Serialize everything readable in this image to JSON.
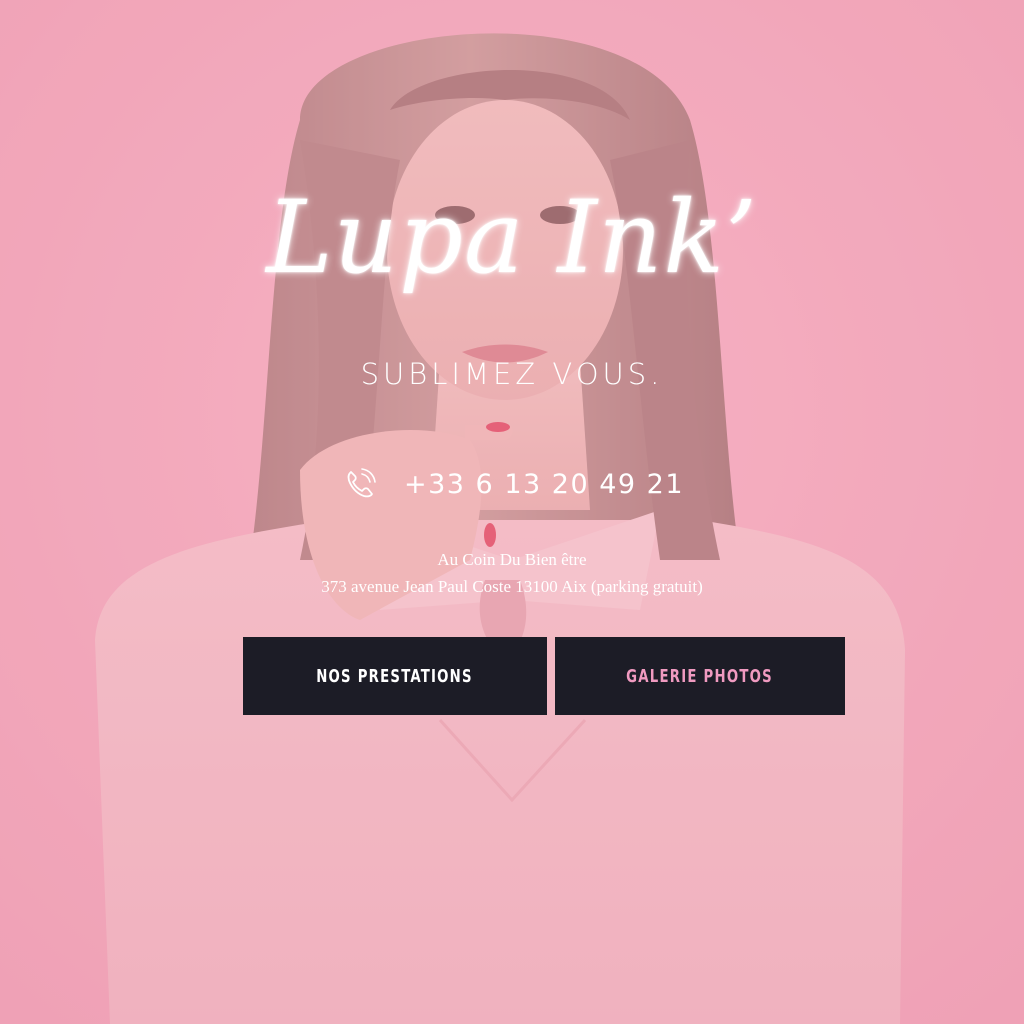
{
  "hero": {
    "logo": "Lupa Ink’",
    "tagline": "SUBLIMEZ VOUS.",
    "phone": "+33 6 13 20 49 21",
    "phone_icon": "phone-icon",
    "address_line1": "Au Coin Du Bien être",
    "address_line2": "373 avenue Jean Paul Coste 13100 Aix (parking gratuit)"
  },
  "buttons": {
    "prestations_label": "NOS PRESTATIONS",
    "galerie_label": "GALERIE PHOTOS"
  },
  "colors": {
    "background_pink": "#f2a9bb",
    "button_bg": "#1c1c26",
    "galerie_text": "#f09ac0",
    "text": "#ffffff"
  }
}
